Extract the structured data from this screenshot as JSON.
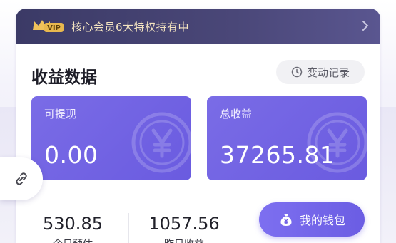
{
  "vip_banner": {
    "badge_text": "VIP",
    "text": "核心会员6大特权持有中",
    "crown_icon": "crown-icon",
    "chevron_icon": "chevron-right-icon"
  },
  "section": {
    "title": "收益数据",
    "history_button": "变动记录",
    "history_icon": "history-icon"
  },
  "stats": {
    "withdrawable": {
      "label": "可提现",
      "value": "0.00"
    },
    "total_income": {
      "label": "总收益",
      "value": "37265.81"
    },
    "watermark_icon": "yuan-coin-icon"
  },
  "mini_stats": {
    "today_estimate": {
      "value": "530.85",
      "label": "今日预估"
    },
    "yesterday_income": {
      "value": "1057.56",
      "label": "昨日收益"
    }
  },
  "wallet_button": {
    "label": "我的钱包",
    "icon": "money-bag-icon"
  },
  "link_fab": {
    "icon": "link-icon"
  },
  "colors": {
    "accent": "#6c5ce4",
    "banner": "#3f3d6e",
    "gold": "#f3e3c0"
  }
}
